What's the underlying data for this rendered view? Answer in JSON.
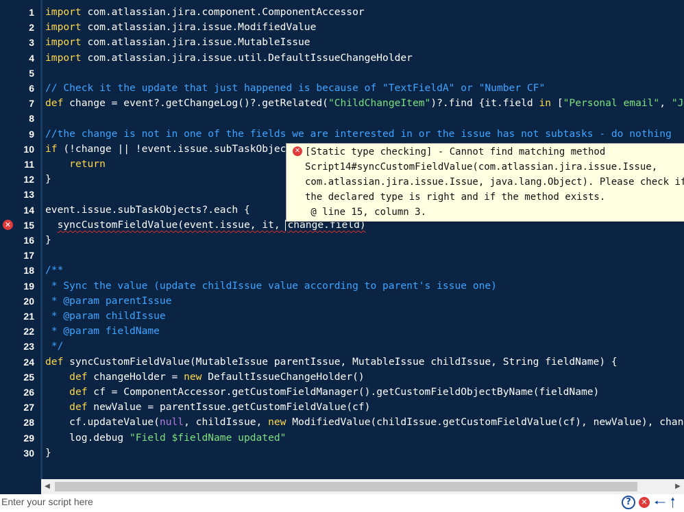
{
  "editor": {
    "line_numbers": [
      "1",
      "2",
      "3",
      "4",
      "5",
      "6",
      "7",
      "8",
      "9",
      "10",
      "11",
      "12",
      "13",
      "14",
      "15",
      "16",
      "17",
      "18",
      "19",
      "20",
      "21",
      "22",
      "23",
      "24",
      "25",
      "26",
      "27",
      "28",
      "29",
      "30"
    ],
    "error_line": "15",
    "lines": [
      [
        {
          "t": "import",
          "c": "kw"
        },
        {
          "t": " com.atlassian.jira.component.ComponentAccessor"
        }
      ],
      [
        {
          "t": "import",
          "c": "kw"
        },
        {
          "t": " com.atlassian.jira.issue.ModifiedValue"
        }
      ],
      [
        {
          "t": "import",
          "c": "kw"
        },
        {
          "t": " com.atlassian.jira.issue.MutableIssue"
        }
      ],
      [
        {
          "t": "import",
          "c": "kw"
        },
        {
          "t": " com.atlassian.jira.issue.util.DefaultIssueChangeHolder"
        }
      ],
      [],
      [
        {
          "t": "// Check it the update that just happened is because of \"TextFieldA\" or \"Number CF\"",
          "c": "cm"
        }
      ],
      [
        {
          "t": "def",
          "c": "kw"
        },
        {
          "t": " change = event?.getChangeLog()?.getRelated("
        },
        {
          "t": "\"ChildChangeItem\"",
          "c": "st"
        },
        {
          "t": ")?.find {it.field "
        },
        {
          "t": "in",
          "c": "kw"
        },
        {
          "t": " ["
        },
        {
          "t": "\"Personal email\"",
          "c": "st"
        },
        {
          "t": ", "
        },
        {
          "t": "\"J",
          "c": "st"
        }
      ],
      [],
      [
        {
          "t": "//the change is not in one of the fields we are interested in or the issue has not subtasks - do nothing",
          "c": "cm"
        }
      ],
      [
        {
          "t": "if",
          "c": "kw"
        },
        {
          "t": " (!change || !event.issue.subTaskObjec"
        }
      ],
      [
        {
          "t": "    "
        },
        {
          "t": "return",
          "c": "kw"
        }
      ],
      [
        {
          "t": "}"
        }
      ],
      [],
      [
        {
          "t": "event.issue.subTaskObjects?.each {"
        }
      ],
      [
        {
          "t": "  "
        },
        {
          "t": "syncCustomFieldValue(event.issue, it, ",
          "c": "eu"
        },
        {
          "caret": true
        },
        {
          "t": "change.field",
          "c": "eu"
        },
        {
          "t": ")",
          "c": "eu"
        }
      ],
      [
        {
          "t": "}"
        }
      ],
      [],
      [
        {
          "t": "/**",
          "c": "cm"
        }
      ],
      [
        {
          "t": " * Sync the value (update childIssue value according to parent's issue one)",
          "c": "cm"
        }
      ],
      [
        {
          "t": " * @param parentIssue",
          "c": "cm"
        }
      ],
      [
        {
          "t": " * @param childIssue",
          "c": "cm"
        }
      ],
      [
        {
          "t": " * @param fieldName",
          "c": "cm"
        }
      ],
      [
        {
          "t": " */",
          "c": "cm"
        }
      ],
      [
        {
          "t": "def",
          "c": "kw"
        },
        {
          "t": " syncCustomFieldValue(MutableIssue parentIssue, MutableIssue childIssue, String fieldName) {"
        }
      ],
      [
        {
          "t": "    "
        },
        {
          "t": "def",
          "c": "kw"
        },
        {
          "t": " changeHolder = "
        },
        {
          "t": "new",
          "c": "kw"
        },
        {
          "t": " DefaultIssueChangeHolder()"
        }
      ],
      [
        {
          "t": "    "
        },
        {
          "t": "def",
          "c": "kw"
        },
        {
          "t": " cf = ComponentAccessor.getCustomFieldManager().getCustomFieldObjectByName(fieldName)"
        }
      ],
      [
        {
          "t": "    "
        },
        {
          "t": "def",
          "c": "kw"
        },
        {
          "t": " newValue = parentIssue.getCustomFieldValue(cf)"
        }
      ],
      [
        {
          "t": "    cf.updateValue("
        },
        {
          "t": "null",
          "c": "nl"
        },
        {
          "t": ", childIssue, "
        },
        {
          "t": "new",
          "c": "kw"
        },
        {
          "t": " ModifiedValue(childIssue.getCustomFieldValue(cf), newValue), chan"
        }
      ],
      [
        {
          "t": "    log.debug "
        },
        {
          "t": "\"Field $fieldName updated\"",
          "c": "st"
        }
      ],
      [
        {
          "t": "}"
        }
      ]
    ]
  },
  "tooltip": {
    "icon": "error-icon",
    "lines": [
      "[Static type checking] - Cannot find matching method",
      "Script14#syncCustomFieldValue(com.atlassian.jira.issue.Issue,",
      "com.atlassian.jira.issue.Issue, java.lang.Object). Please check if",
      "the declared type is right and if the method exists.",
      " @ line 15, column 3."
    ]
  },
  "statusbar": {
    "placeholder": "Enter your script here",
    "help_icon": "?",
    "error_icon": "✕",
    "back_icon": "🡐",
    "up_icon": "🡑"
  },
  "colors": {
    "background": "#0b2443",
    "keyword": "#ffd84a",
    "comment": "#3fa4ff",
    "string": "#7ee07e",
    "null_literal": "#b07be0",
    "error": "#e03a3a"
  }
}
